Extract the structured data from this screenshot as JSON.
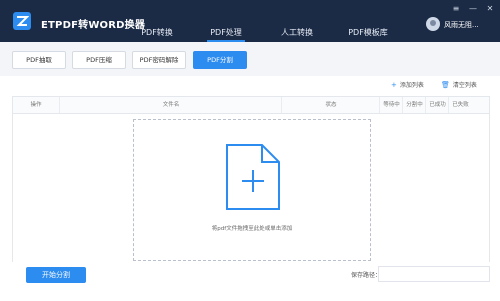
{
  "app": {
    "title": "ETPDF转WORD换器"
  },
  "nav": {
    "items": [
      {
        "label": "PDF转换"
      },
      {
        "label": "PDF处理"
      },
      {
        "label": "人工转换"
      },
      {
        "label": "PDF模板库"
      }
    ],
    "active_index": 1
  },
  "user": {
    "name": "风雨无阻..."
  },
  "window_controls": {
    "menu": "≡",
    "minimize": "—",
    "close": "✕"
  },
  "tools": {
    "items": [
      {
        "label": "PDF抽取"
      },
      {
        "label": "PDF压缩"
      },
      {
        "label": "PDF密码解除"
      },
      {
        "label": "PDF分割"
      }
    ],
    "active_index": 3
  },
  "actions": {
    "add_list": "添加列表",
    "clear_list": "清空列表"
  },
  "table": {
    "headers": [
      "操作",
      "文件名",
      "状态",
      "等待中",
      "分割中",
      "已成功",
      "已失败"
    ],
    "drop_hint": "将pdf文件拖拽至此处或单击添加"
  },
  "bottom": {
    "start_label": "开始分割",
    "save_path_label": "保存路径："
  },
  "colors": {
    "titlebar": "#1b2a45",
    "accent": "#2d8cf0"
  }
}
